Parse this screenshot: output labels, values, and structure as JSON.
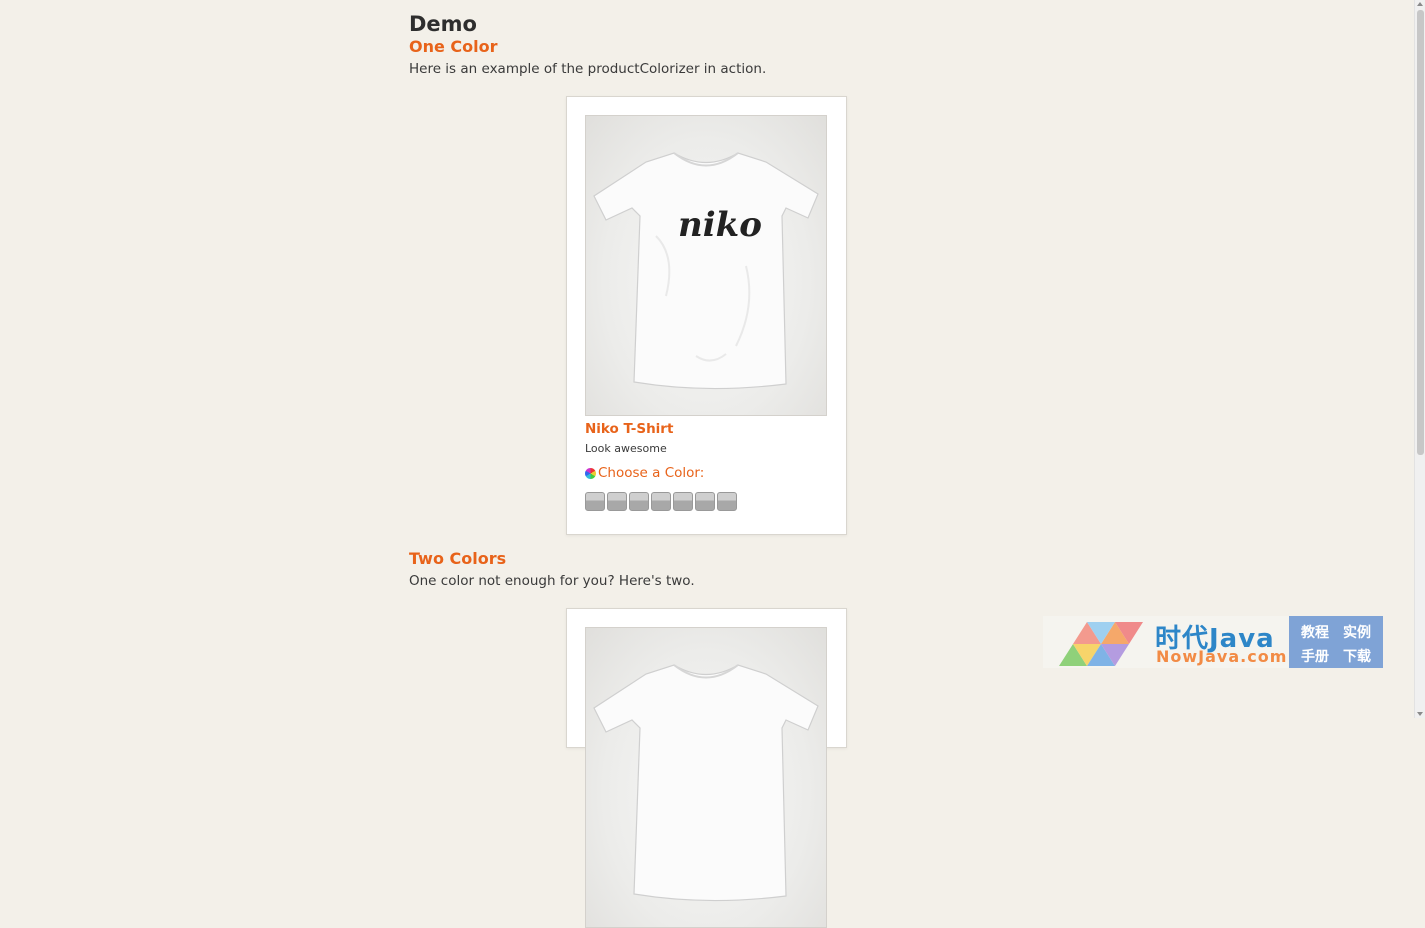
{
  "demo_heading": "Demo",
  "sections": [
    {
      "title": "One Color",
      "description": "Here is an example of the productColorizer in action.",
      "product": {
        "image_text": "niko",
        "name": "Niko T-Shirt",
        "tagline": "Look awesome",
        "color_prompt": "Choose a Color:",
        "swatch_count": 7
      }
    },
    {
      "title": "Two Colors",
      "description": "One color not enough for you? Here's two."
    }
  ],
  "watermark": {
    "cn_name": "时代Java",
    "en_name": "NowJava.com",
    "links": [
      "教程",
      "实例",
      "手册",
      "下载"
    ]
  }
}
